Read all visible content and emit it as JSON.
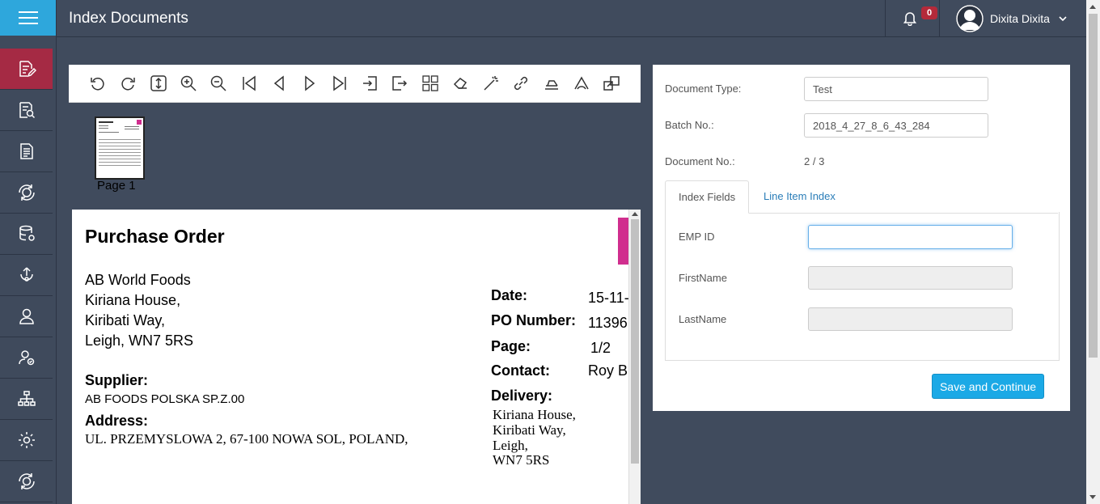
{
  "header": {
    "title": "Index Documents",
    "notification_count": "0",
    "user_name": "Dixita Dixita"
  },
  "sidebar": {
    "items": [
      {
        "icon": "edit-document-icon",
        "active": true
      },
      {
        "icon": "search-document-icon"
      },
      {
        "icon": "document-icon"
      },
      {
        "icon": "sync-icon"
      },
      {
        "icon": "database-icon"
      },
      {
        "icon": "upload-icon"
      },
      {
        "icon": "user-icon"
      },
      {
        "icon": "user-settings-icon"
      },
      {
        "icon": "hierarchy-icon"
      },
      {
        "icon": "gear-icon"
      },
      {
        "icon": "refresh-cycle-icon"
      }
    ]
  },
  "viewer": {
    "toolbar_icons": [
      "rotate-left-icon",
      "rotate-right-icon",
      "fit-height-icon",
      "zoom-in-icon",
      "zoom-out-icon",
      "first-page-icon",
      "previous-page-icon",
      "next-page-icon",
      "last-page-icon",
      "import-icon",
      "export-icon",
      "grid-icon",
      "erase-icon",
      "magic-wand-icon",
      "link-icon",
      "stamp-icon",
      "annotate-icon",
      "split-icon"
    ],
    "thumbnail_label": "Page 1",
    "document": {
      "title": "Purchase Order",
      "address_lines": [
        "AB World Foods",
        "Kiriana House,",
        "Kiribati Way,",
        "Leigh, WN7 5RS"
      ],
      "supplier_label": "Supplier:",
      "supplier_value": "AB FOODS POLSKA SP.Z.00",
      "address_label": "Address:",
      "address_value": "UL. PRZEMYSLOWA 2, 67-100 NOWA SOL, POLAND,",
      "date_label": "Date:",
      "date_value": "15-11-",
      "po_label": "PO Number:",
      "po_value": "11396",
      "page_label": "Page:",
      "page_value": "1/2",
      "contact_label": "Contact:",
      "contact_value": "Roy B",
      "delivery_label": "Delivery:",
      "delivery_lines": [
        "Kiriana House,",
        "Kiribati Way,",
        "Leigh,",
        "WN7 5RS"
      ]
    }
  },
  "form": {
    "document_type_label": "Document Type:",
    "document_type_value": "Test",
    "batch_no_label": "Batch No.:",
    "batch_no_value": "2018_4_27_8_6_43_284",
    "document_no_label": "Document No.:",
    "document_no_value": "2 / 3",
    "tabs": [
      {
        "label": "Index Fields",
        "active": true
      },
      {
        "label": "Line Item Index",
        "active": false
      }
    ],
    "fields": [
      {
        "label": "EMP ID",
        "value": ""
      },
      {
        "label": "FirstName",
        "value": ""
      },
      {
        "label": "LastName",
        "value": ""
      }
    ],
    "save_label": "Save and Continue"
  },
  "colors": {
    "accent": "#1ba9e6",
    "sidebar_active": "#a52a44",
    "header_bg": "#404b5d",
    "hamburger_bg": "#2ea7dc"
  }
}
